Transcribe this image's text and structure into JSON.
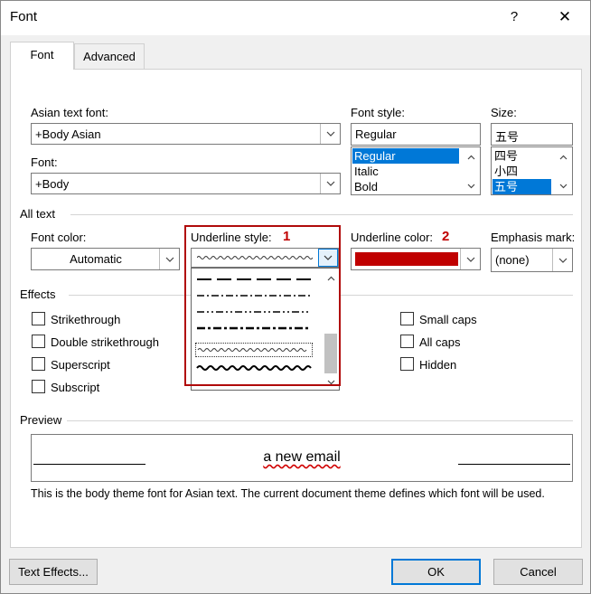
{
  "window": {
    "title": "Font",
    "help_label": "?",
    "close_label": "✕"
  },
  "tabs": [
    {
      "label": "Font",
      "active": true
    },
    {
      "label": "Advanced",
      "active": false
    }
  ],
  "asian_font": {
    "label": "Asian text font:",
    "value": "+Body Asian"
  },
  "latin_font": {
    "label": "Font:",
    "value": "+Body"
  },
  "font_style": {
    "label": "Font style:",
    "value": "Regular",
    "options": [
      "Regular",
      "Italic",
      "Bold"
    ],
    "selected": "Regular"
  },
  "size": {
    "label": "Size:",
    "value": "五号",
    "options": [
      "四号",
      "小四",
      "五号"
    ],
    "selected": "五号"
  },
  "all_text": {
    "section_label": "All text",
    "font_color": {
      "label": "Font color:",
      "value": "Automatic"
    },
    "underline_style": {
      "label": "Underline style:",
      "annotation": "1"
    },
    "underline_color": {
      "label": "Underline color:",
      "annotation": "2",
      "color": "#c00000"
    },
    "emphasis_mark": {
      "label": "Emphasis mark:",
      "value": "(none)"
    }
  },
  "effects": {
    "section_label": "Effects",
    "left": [
      {
        "label": "Strikethrough",
        "checked": false
      },
      {
        "label": "Double strikethrough",
        "checked": false
      },
      {
        "label": "Superscript",
        "checked": false
      },
      {
        "label": "Subscript",
        "checked": false
      }
    ],
    "right": [
      {
        "label": "Small caps",
        "checked": false
      },
      {
        "label": "All caps",
        "checked": false
      },
      {
        "label": "Hidden",
        "checked": false
      }
    ]
  },
  "underline_dropdown": {
    "options": [
      "dash-long",
      "dash-dot",
      "dash-dot-dot",
      "thick-dash-dot",
      "wave",
      "heavy-wave"
    ],
    "selected": "wave",
    "highlight_color": "#b00a0a"
  },
  "preview": {
    "section_label": "Preview",
    "sample_text": "a new email",
    "note": "This is the body theme font for Asian text. The current document theme defines which font will be used."
  },
  "buttons": {
    "text_effects": "Text Effects...",
    "ok": "OK",
    "cancel": "Cancel"
  },
  "colors": {
    "accent": "#0078d7",
    "callout": "#b00a0a"
  }
}
